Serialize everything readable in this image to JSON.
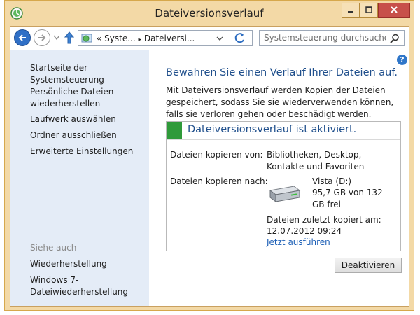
{
  "window": {
    "title": "Dateiversionsverlauf"
  },
  "navbar": {
    "address": {
      "prefix": "«",
      "segments": [
        "Syste...",
        "Dateiversi..."
      ],
      "separator": "▸"
    },
    "search_placeholder": "Systemsteuerung durchsuchen"
  },
  "sidebar": {
    "home": "Startseite der Systemsteuerung",
    "links": [
      "Persönliche Dateien wiederherstellen",
      "Laufwerk auswählen",
      "Ordner ausschließen",
      "Erweiterte Einstellungen"
    ],
    "see_also_title": "Siehe auch",
    "see_also": [
      "Wiederherstellung",
      "Windows 7-Dateiwiederherstellung"
    ]
  },
  "main": {
    "heading": "Bewahren Sie einen Verlauf Ihrer Dateien auf.",
    "description": "Mit Dateiversionsverlauf werden Kopien der Dateien gespeichert, sodass Sie sie wiederverwenden können, falls sie verloren gehen oder beschädigt werden.",
    "status_title": "Dateiversionsverlauf ist aktiviert.",
    "copy_from_label": "Dateien kopieren von:",
    "copy_from_value": "Bibliotheken, Desktop, Kontakte und Favoriten",
    "copy_to_label": "Dateien kopieren nach:",
    "drive_name": "Vista (D:)",
    "drive_space": "95,7 GB von 132 GB frei",
    "last_copied_label": "Dateien zuletzt kopiert am:",
    "last_copied_value": "12.07.2012 09:24",
    "run_now": "Jetzt ausführen",
    "deactivate_button": "Deaktivieren"
  },
  "icons": {
    "back": "back-arrow-icon",
    "forward": "forward-arrow-icon",
    "up": "up-arrow-icon",
    "refresh": "refresh-icon",
    "search": "search-icon",
    "help": "help-icon",
    "drive": "hard-drive-icon",
    "app": "file-history-icon"
  },
  "help_glyph": "?",
  "colors": {
    "frame": "#f3d9a6",
    "sidebar": "#e4ecf7",
    "heading": "#1f4f8c",
    "link": "#1c5fb6",
    "status_green": "#2f9a3a",
    "close_button": "#c7504a"
  }
}
